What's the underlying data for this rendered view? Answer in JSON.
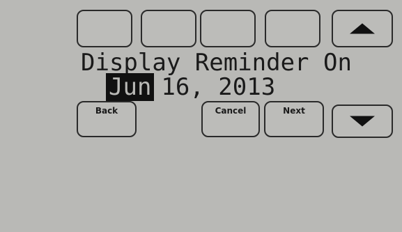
{
  "reminder": {
    "title": "Display Reminder On",
    "date": {
      "month": "Jun",
      "rest": "16, 2013"
    }
  },
  "buttons": {
    "back": "Back",
    "cancel": "Cancel",
    "next": "Next"
  },
  "icons": {
    "up": "arrow-up-icon",
    "down": "arrow-down-icon"
  },
  "colors": {
    "background": "#b9b9b6",
    "foreground": "#111111"
  }
}
